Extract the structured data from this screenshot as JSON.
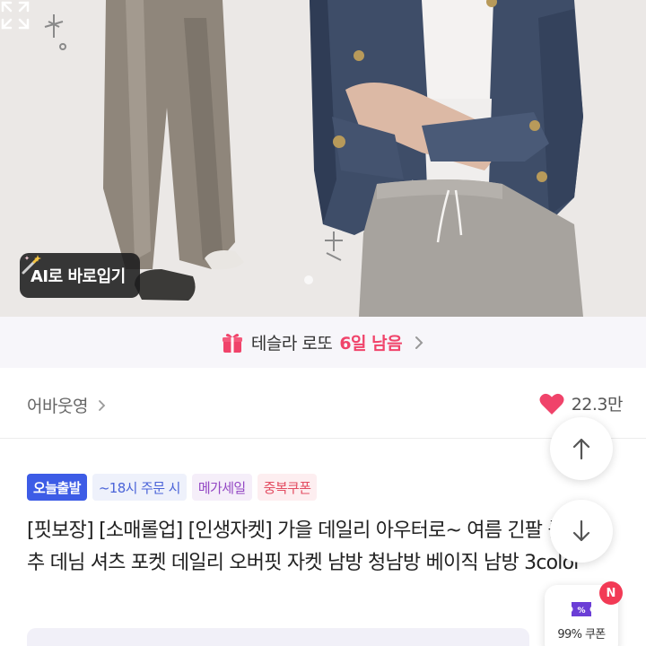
{
  "hero": {
    "ai_button_label": "AI로 바로입기",
    "ai_icon": "magic-wand-icon",
    "expand_icon": "expand-icon"
  },
  "promo": {
    "text": "테슬라 로또",
    "highlight": "6일 남음",
    "icon": "gift-icon",
    "accent_color": "#f0436a"
  },
  "shop": {
    "name": "어바웃영",
    "likes": "22.3만",
    "like_color": "#f0436a"
  },
  "badges": [
    {
      "label": "오늘출발"
    },
    {
      "label": "~18시 주문 시"
    },
    {
      "label": "메가세일"
    },
    {
      "label": "중복쿠폰"
    }
  ],
  "product": {
    "title": "[핏보장] [소매롤업] [인생자켓] 가을 데일리 아우터로~ 여름 긴팔 롤업 단추 데님 셔츠 포켓 데일리 오버핏 자켓 남방 청남방 베이직 남방 3color"
  },
  "floating": {
    "scroll_up_icon": "arrow-up-icon",
    "scroll_down_icon": "arrow-down-icon",
    "coupon_label": "99% 쿠폰",
    "new_badge": "N"
  }
}
